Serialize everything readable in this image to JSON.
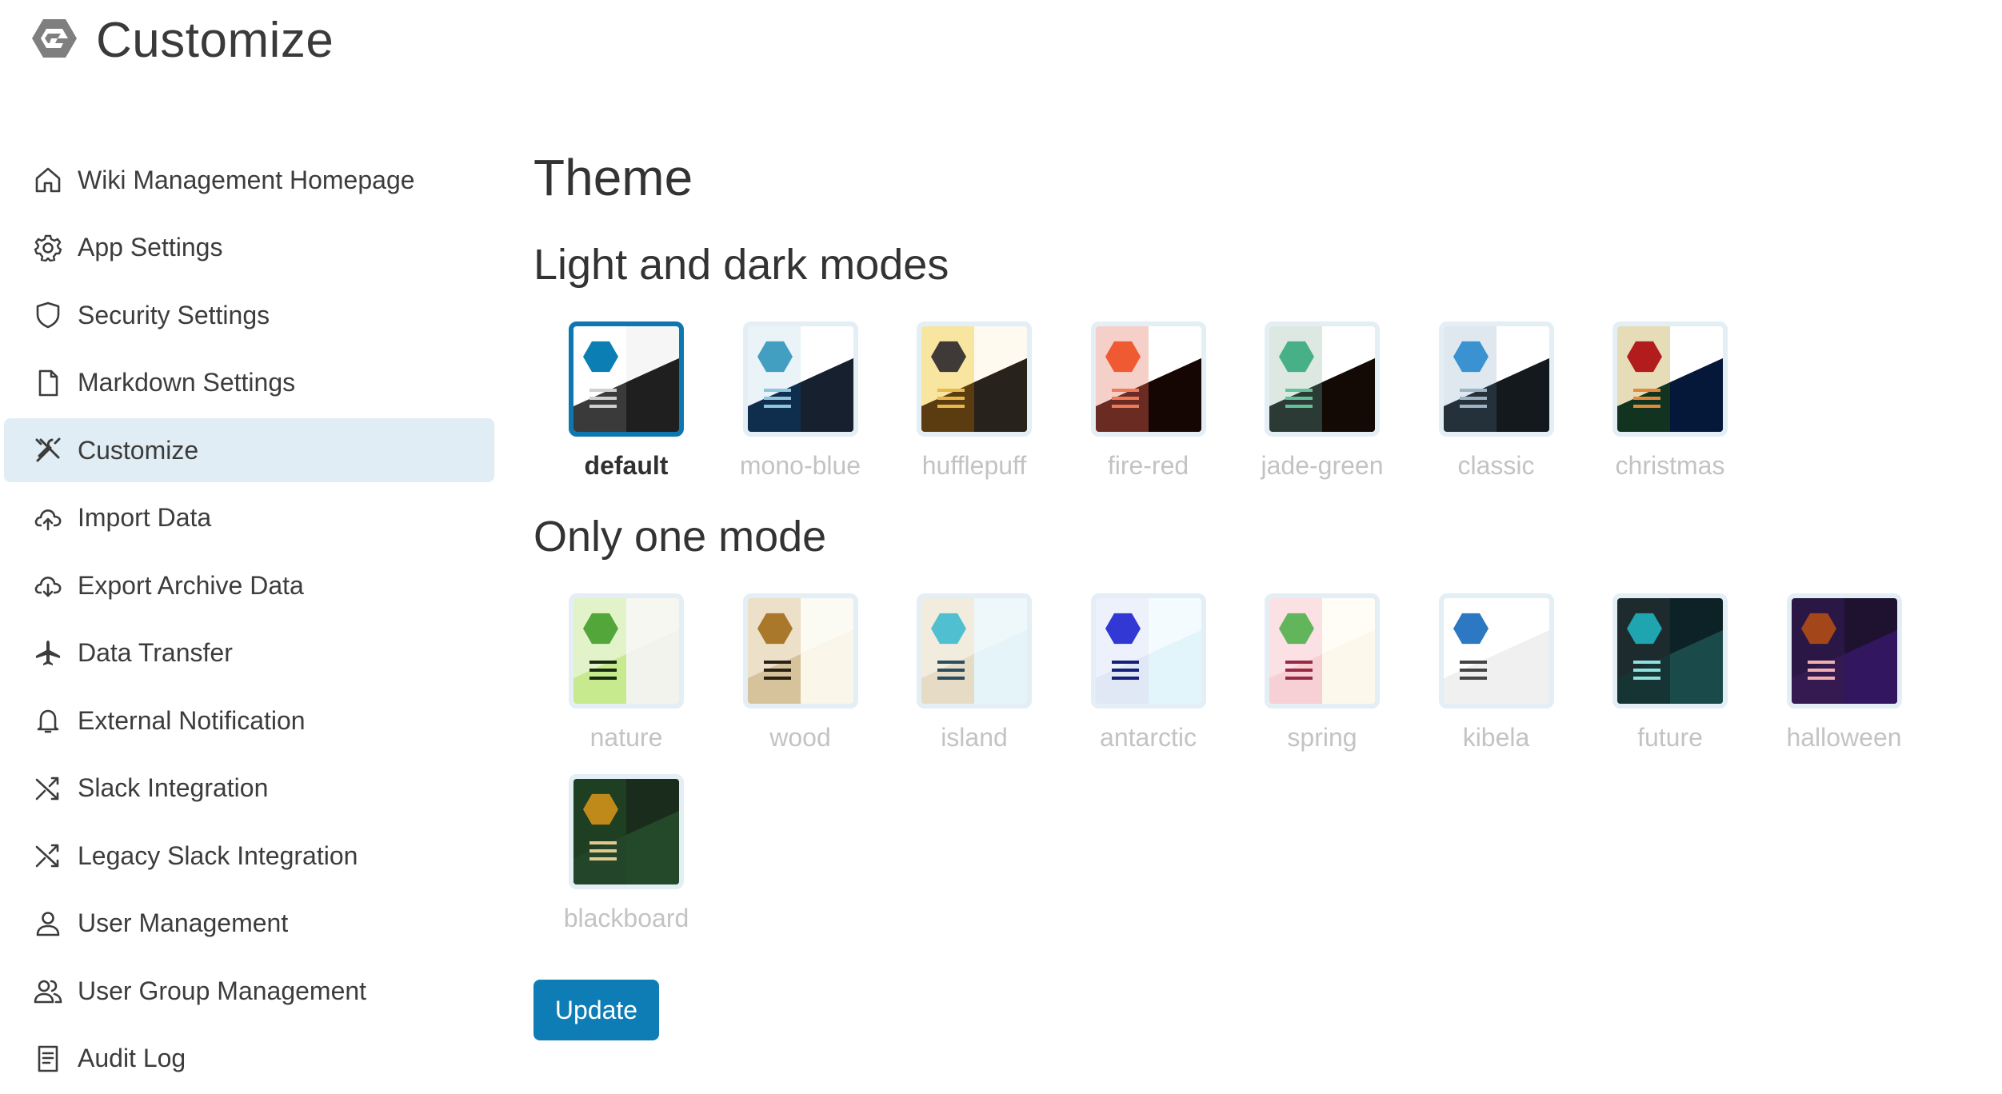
{
  "page": {
    "title": "Customize",
    "logo_icon": "growi-logo-icon"
  },
  "sidebar": {
    "items": [
      {
        "label": "Wiki Management Homepage",
        "icon": "home-icon",
        "active": false
      },
      {
        "label": "App Settings",
        "icon": "gear-icon",
        "active": false
      },
      {
        "label": "Security Settings",
        "icon": "shield-icon",
        "active": false
      },
      {
        "label": "Markdown Settings",
        "icon": "file-icon",
        "active": false
      },
      {
        "label": "Customize",
        "icon": "tools-icon",
        "active": true
      },
      {
        "label": "Import Data",
        "icon": "cloud-upload-icon",
        "active": false
      },
      {
        "label": "Export Archive Data",
        "icon": "cloud-download-icon",
        "active": false
      },
      {
        "label": "Data Transfer",
        "icon": "airplane-icon",
        "active": false
      },
      {
        "label": "External Notification",
        "icon": "bell-icon",
        "active": false
      },
      {
        "label": "Slack Integration",
        "icon": "shuffle-icon",
        "active": false
      },
      {
        "label": "Legacy Slack Integration",
        "icon": "shuffle-icon",
        "active": false
      },
      {
        "label": "User Management",
        "icon": "user-icon",
        "active": false
      },
      {
        "label": "User Group Management",
        "icon": "users-icon",
        "active": false
      },
      {
        "label": "Audit Log",
        "icon": "list-icon",
        "active": false
      }
    ]
  },
  "main": {
    "heading": "Theme",
    "light_dark": {
      "heading": "Light and dark modes",
      "themes": [
        {
          "name": "default",
          "selected": true,
          "left": "#ffffff",
          "right": "#f6f6f6",
          "dark": "#1f1f1f",
          "darkLeft": "#3a3a3a",
          "hex": "#0b7fb3",
          "lines": "#cfcfcf"
        },
        {
          "name": "mono-blue",
          "selected": false,
          "left": "#e9f3f8",
          "right": "#ffffff",
          "dark": "#17202e",
          "darkLeft": "#0f2d4d",
          "hex": "#429fc1",
          "lines": "#8fc4dd"
        },
        {
          "name": "hufflepuff",
          "selected": false,
          "left": "#f8e6a0",
          "right": "#fffaf0",
          "dark": "#27221c",
          "darkLeft": "#5a3c10",
          "hex": "#3f3a37",
          "lines": "#e8b94a"
        },
        {
          "name": "fire-red",
          "selected": false,
          "left": "#f5d0c8",
          "right": "#ffffff",
          "dark": "#150604",
          "darkLeft": "#6a2c22",
          "hex": "#ef5a32",
          "lines": "#ef7a5a"
        },
        {
          "name": "jade-green",
          "selected": false,
          "left": "#dde8e2",
          "right": "#ffffff",
          "dark": "#130a05",
          "darkLeft": "#2b3a34",
          "hex": "#48b087",
          "lines": "#62c29a"
        },
        {
          "name": "classic",
          "selected": false,
          "left": "#dfe8ef",
          "right": "#ffffff",
          "dark": "#14191e",
          "darkLeft": "#24303a",
          "hex": "#3b92d1",
          "lines": "#9fb2c2"
        },
        {
          "name": "christmas",
          "selected": false,
          "left": "#e6dcb8",
          "right": "#ffffff",
          "dark": "#06183a",
          "darkLeft": "#123320",
          "hex": "#b21c1c",
          "lines": "#e08a3a"
        }
      ]
    },
    "one_mode": {
      "heading": "Only one mode",
      "themes": [
        {
          "name": "nature",
          "selected": false,
          "left": "#e3f3c9",
          "right": "#f7f7f2",
          "dark": "#f3f3ee",
          "darkLeft": "#c7ea8f",
          "hex": "#52a63a",
          "lines": "#1a2a10"
        },
        {
          "name": "wood",
          "selected": false,
          "left": "#ede0c8",
          "right": "#fbfaf3",
          "dark": "#faf6ea",
          "darkLeft": "#d7c39b",
          "hex": "#a9782a",
          "lines": "#2a2015"
        },
        {
          "name": "island",
          "selected": false,
          "left": "#f1ecde",
          "right": "#eef8fb",
          "dark": "#e4f4f8",
          "darkLeft": "#e6dcc6",
          "hex": "#50c0d0",
          "lines": "#2b4b5e"
        },
        {
          "name": "antarctic",
          "selected": false,
          "left": "#edf1fb",
          "right": "#f4fbfe",
          "dark": "#e2f5fb",
          "darkLeft": "#e0e8f6",
          "hex": "#3138d4",
          "lines": "#15207a"
        },
        {
          "name": "spring",
          "selected": false,
          "left": "#fbe0e4",
          "right": "#fffdf5",
          "dark": "#fdf8ec",
          "darkLeft": "#f7d0d6",
          "hex": "#62b55a",
          "lines": "#9a2a44"
        },
        {
          "name": "kibela",
          "selected": false,
          "left": "#ffffff",
          "right": "#ffffff",
          "dark": "#f0f0f0",
          "darkLeft": "#f0f0f0",
          "hex": "#2d78c2",
          "lines": "#444444"
        },
        {
          "name": "future",
          "selected": false,
          "left": "#1d2b2e",
          "right": "#0d2226",
          "dark": "#1b4a4a",
          "darkLeft": "#163433",
          "hex": "#1fa5b0",
          "lines": "#8fe0e0"
        },
        {
          "name": "halloween",
          "selected": false,
          "left": "#2a1745",
          "right": "#1e1230",
          "dark": "#321660",
          "darkLeft": "#341a50",
          "hex": "#a3471a",
          "lines": "#f0b0b0"
        },
        {
          "name": "blackboard",
          "selected": false,
          "left": "#1f3f22",
          "right": "#1a2d1d",
          "dark": "#24482a",
          "darkLeft": "#23462a",
          "hex": "#c08a1a",
          "lines": "#e4c890"
        }
      ]
    },
    "update_label": "Update"
  }
}
